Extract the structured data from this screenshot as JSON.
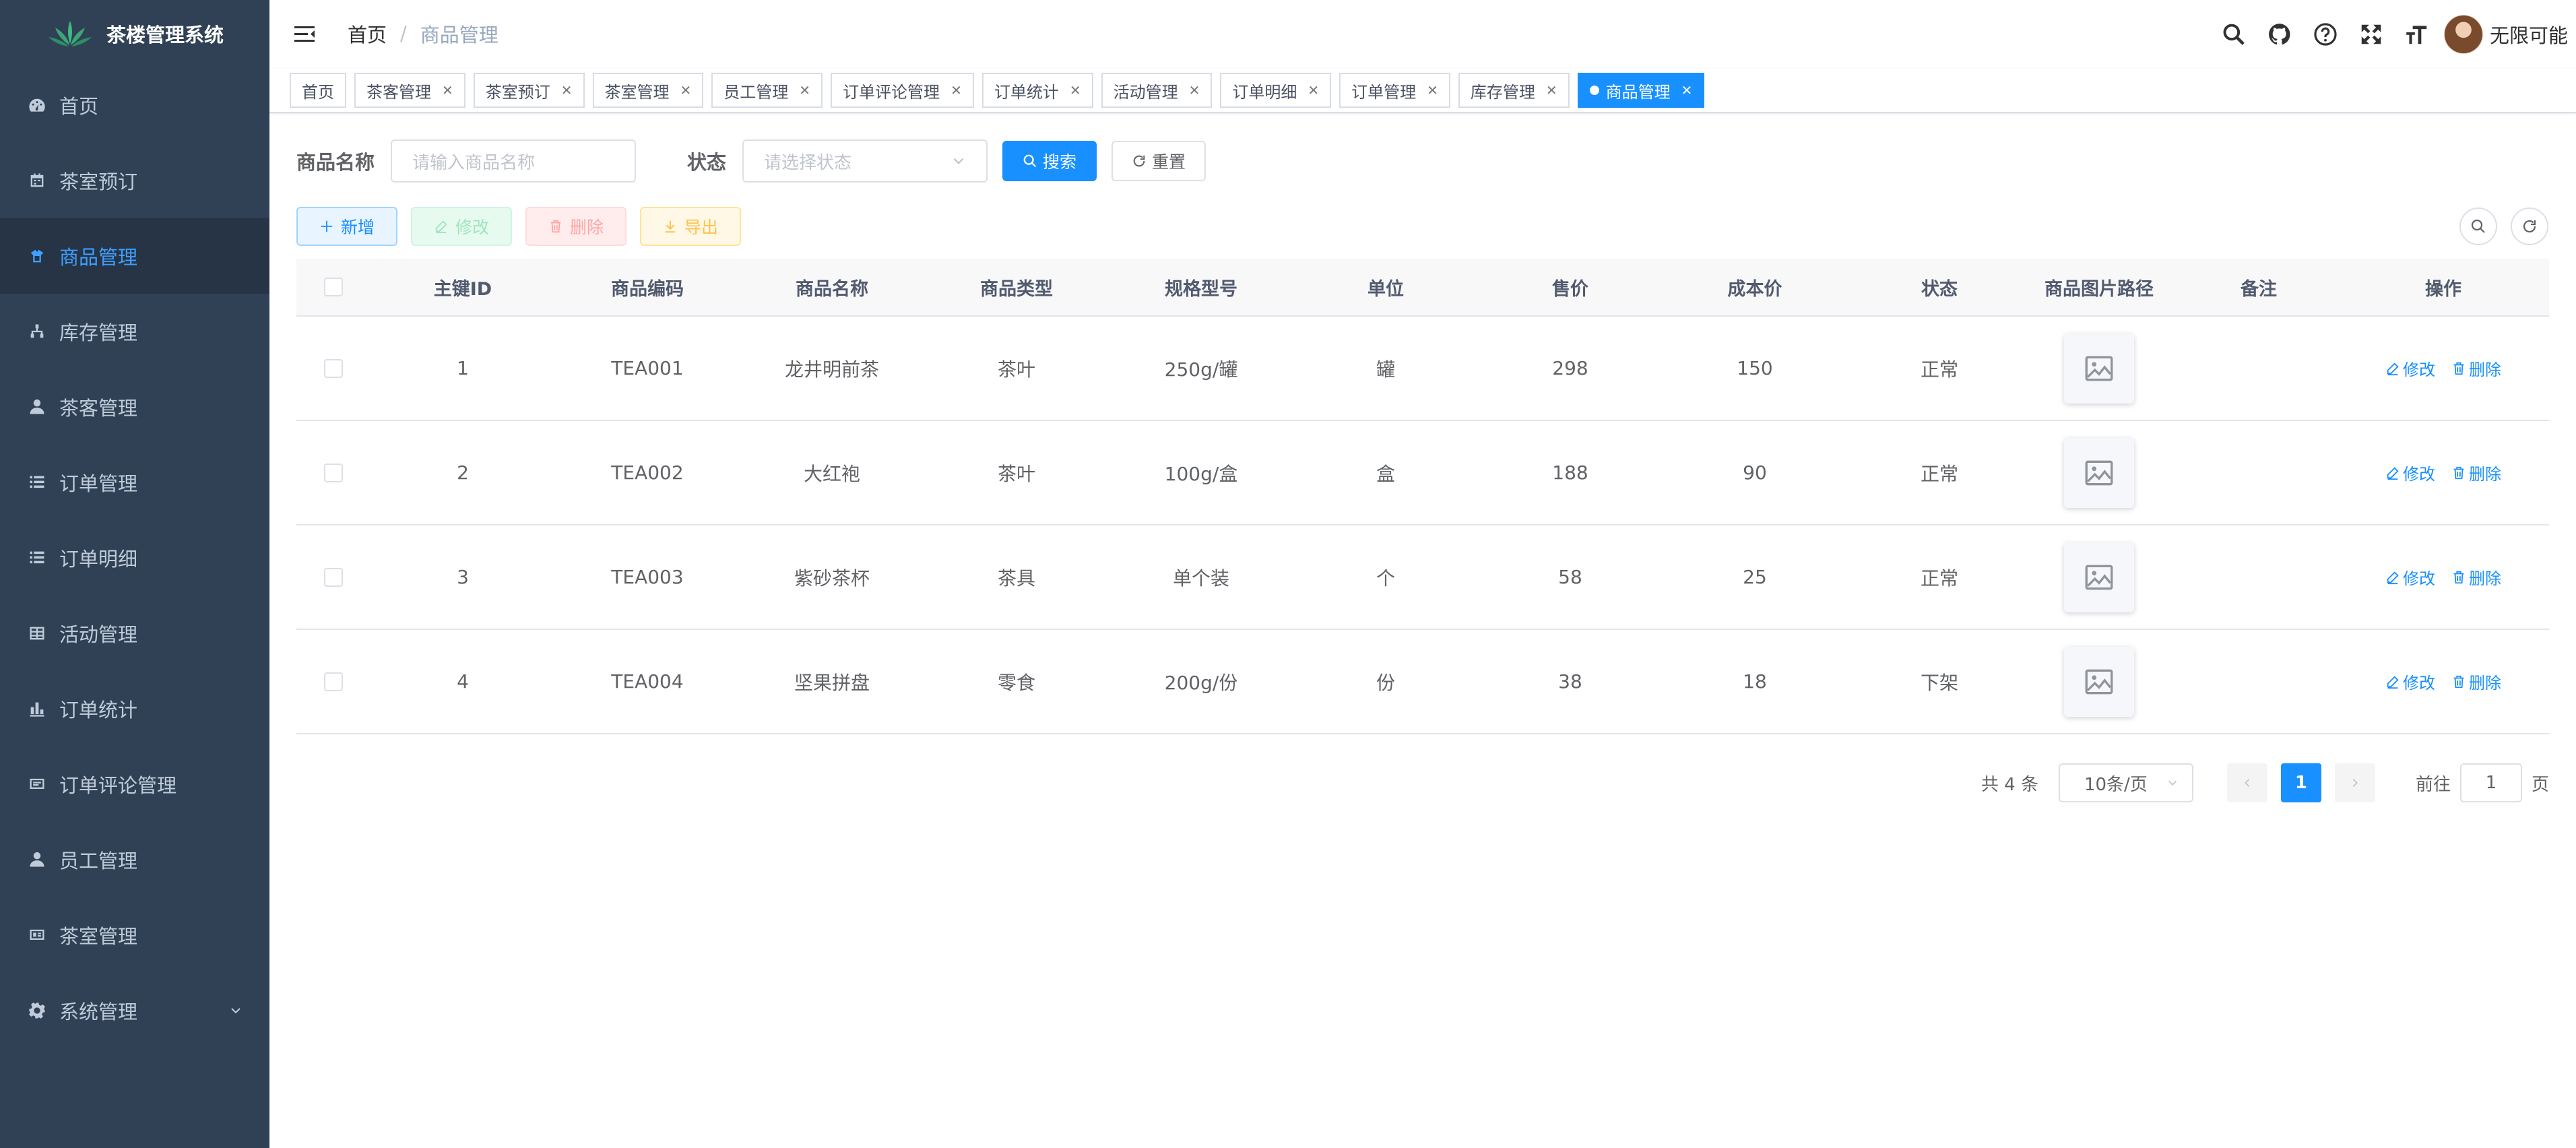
{
  "app": {
    "title": "茶楼管理系统"
  },
  "sidebar": {
    "items": [
      {
        "label": "首页",
        "icon": "dashboard-icon"
      },
      {
        "label": "茶室预订",
        "icon": "calendar-icon"
      },
      {
        "label": "商品管理",
        "icon": "goods-icon",
        "active": true
      },
      {
        "label": "库存管理",
        "icon": "tree-icon"
      },
      {
        "label": "茶客管理",
        "icon": "user-icon"
      },
      {
        "label": "订单管理",
        "icon": "list-icon"
      },
      {
        "label": "订单明细",
        "icon": "list-icon"
      },
      {
        "label": "活动管理",
        "icon": "table-icon"
      },
      {
        "label": "订单统计",
        "icon": "chart-icon"
      },
      {
        "label": "订单评论管理",
        "icon": "message-icon"
      },
      {
        "label": "员工管理",
        "icon": "user-icon"
      },
      {
        "label": "茶室管理",
        "icon": "room-icon"
      },
      {
        "label": "系统管理",
        "icon": "gear-icon",
        "expandable": true
      }
    ]
  },
  "breadcrumb": {
    "home": "首页",
    "sep": "/",
    "current": "商品管理"
  },
  "user": {
    "name": "无限可能"
  },
  "tags": [
    {
      "label": "首页",
      "closable": false
    },
    {
      "label": "茶客管理",
      "closable": true
    },
    {
      "label": "茶室预订",
      "closable": true
    },
    {
      "label": "茶室管理",
      "closable": true
    },
    {
      "label": "员工管理",
      "closable": true
    },
    {
      "label": "订单评论管理",
      "closable": true
    },
    {
      "label": "订单统计",
      "closable": true
    },
    {
      "label": "活动管理",
      "closable": true
    },
    {
      "label": "订单明细",
      "closable": true
    },
    {
      "label": "订单管理",
      "closable": true
    },
    {
      "label": "库存管理",
      "closable": true
    },
    {
      "label": "商品管理",
      "closable": true,
      "active": true
    }
  ],
  "search": {
    "name_label": "商品名称",
    "name_placeholder": "请输入商品名称",
    "status_label": "状态",
    "status_placeholder": "请选择状态",
    "search_btn": "搜索",
    "reset_btn": "重置"
  },
  "toolbar": {
    "add": "新增",
    "edit": "修改",
    "delete": "删除",
    "export": "导出"
  },
  "table": {
    "headers": [
      "主键ID",
      "商品编码",
      "商品名称",
      "商品类型",
      "规格型号",
      "单位",
      "售价",
      "成本价",
      "状态",
      "商品图片路径",
      "备注",
      "操作"
    ],
    "rows": [
      {
        "id": "1",
        "code": "TEA001",
        "name": "龙井明前茶",
        "type": "茶叶",
        "spec": "250g/罐",
        "unit": "罐",
        "price": "298",
        "cost": "150",
        "status": "正常",
        "remark": ""
      },
      {
        "id": "2",
        "code": "TEA002",
        "name": "大红袍",
        "type": "茶叶",
        "spec": "100g/盒",
        "unit": "盒",
        "price": "188",
        "cost": "90",
        "status": "正常",
        "remark": ""
      },
      {
        "id": "3",
        "code": "TEA003",
        "name": "紫砂茶杯",
        "type": "茶具",
        "spec": "单个装",
        "unit": "个",
        "price": "58",
        "cost": "25",
        "status": "正常",
        "remark": ""
      },
      {
        "id": "4",
        "code": "TEA004",
        "name": "坚果拼盘",
        "type": "零食",
        "spec": "200g/份",
        "unit": "份",
        "price": "38",
        "cost": "18",
        "status": "下架",
        "remark": ""
      }
    ],
    "op_edit": "修改",
    "op_delete": "删除"
  },
  "pagination": {
    "total_text": "共 4 条",
    "page_size": "10条/页",
    "current_page": "1",
    "goto_label": "前往",
    "goto_value": "1",
    "page_suffix": "页"
  },
  "colors": {
    "sidebar_bg": "#304156",
    "primary": "#1890ff",
    "active_menu_text": "#409eff"
  }
}
